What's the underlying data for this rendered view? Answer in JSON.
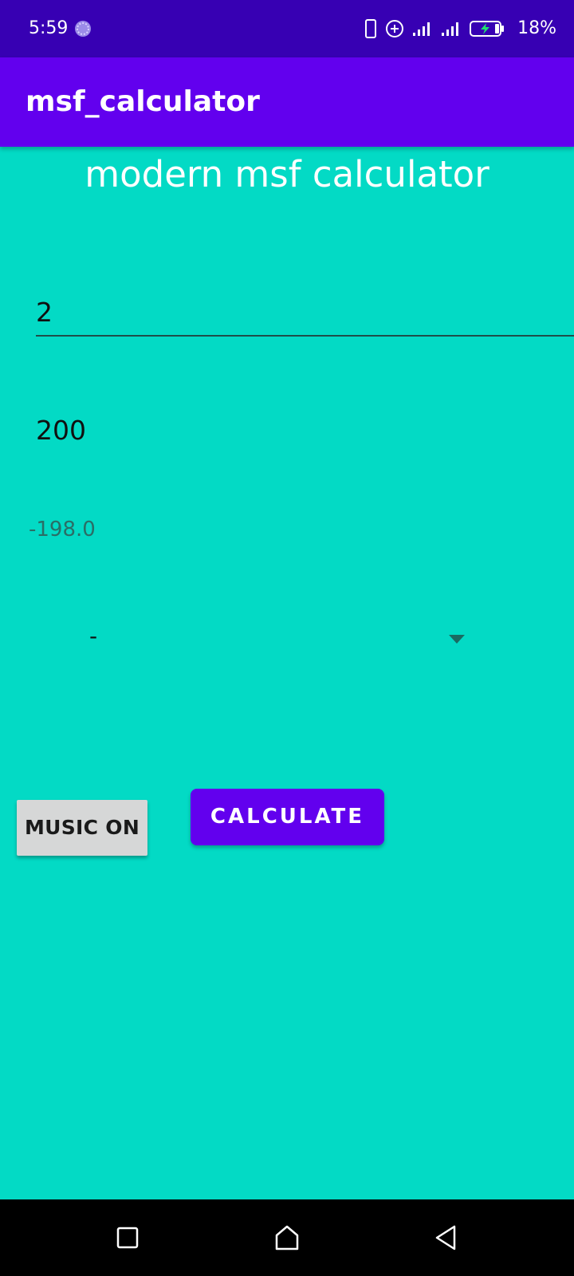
{
  "status_bar": {
    "time": "5:59",
    "battery_percent": "18%",
    "icons": [
      "loading-spinner-icon",
      "vibrate-icon",
      "data-saver-icon",
      "signal-icon",
      "signal-icon",
      "battery-charging-icon"
    ]
  },
  "app_bar": {
    "title": "msf_calculator",
    "color": "#6200EE"
  },
  "main": {
    "heading": "modern msf calculator",
    "input_1": {
      "value": "2"
    },
    "input_2": {
      "value": "200"
    },
    "result": "-198.0",
    "operator_select": {
      "selected": "-"
    },
    "music_button": {
      "label": "MUSIC ON"
    },
    "calculate_button": {
      "label": "CALCULATE"
    },
    "background_color": "#03DAC5"
  },
  "nav_bar": {
    "buttons": [
      "recents-icon",
      "home-icon",
      "back-icon"
    ]
  }
}
